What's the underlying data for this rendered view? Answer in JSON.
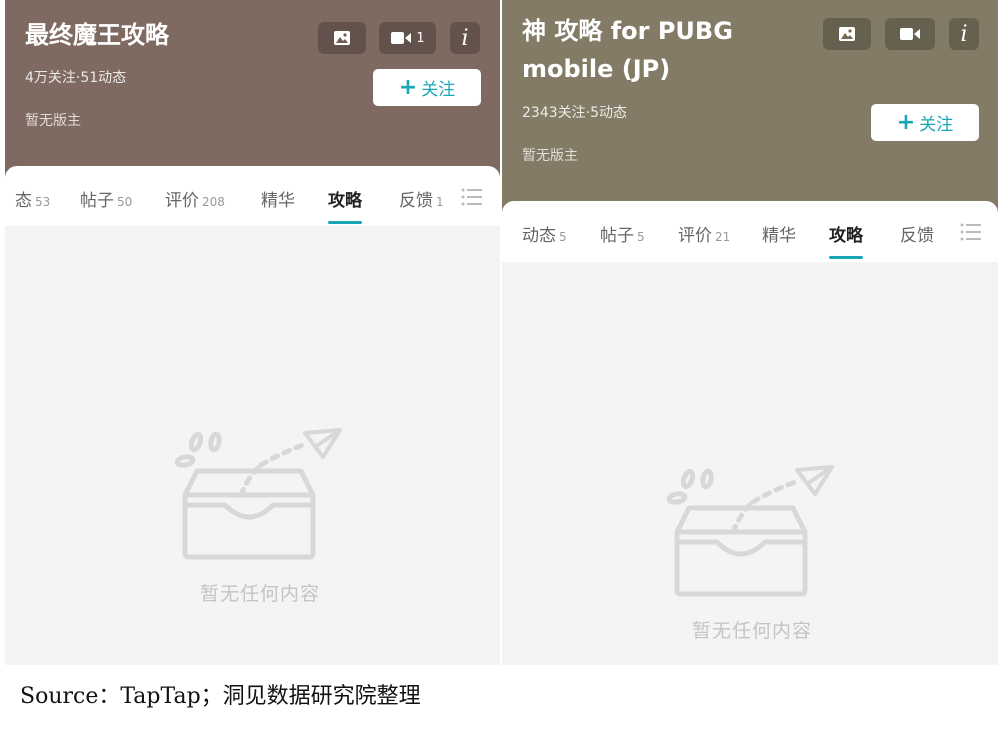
{
  "colors": {
    "left_header_bg": "#7f6a62",
    "right_header_bg": "#837b66",
    "accent": "#1aa7b5",
    "content_bg": "#f4f4f3",
    "empty_illustration": "#d8d8d8"
  },
  "left": {
    "title": "最终魔王攻略",
    "stats": "4万关注·51动态",
    "moderator": "暂无版主",
    "video_count": "1",
    "follow_label": "关注",
    "tabs": [
      {
        "label": "态",
        "count": "53"
      },
      {
        "label": "帖子",
        "count": "50"
      },
      {
        "label": "评价",
        "count": "208"
      },
      {
        "label": "精华",
        "count": ""
      },
      {
        "label": "攻略",
        "count": ""
      },
      {
        "label": "反馈",
        "count": "1"
      }
    ],
    "active_tab": "攻略",
    "empty_text": "暂无任何内容"
  },
  "right": {
    "title": "神 攻略 for PUBG mobile (JP)",
    "stats": "2343关注·5动态",
    "moderator": "暂无版主",
    "follow_label": "关注",
    "tabs": [
      {
        "label": "动态",
        "count": "5"
      },
      {
        "label": "帖子",
        "count": "5"
      },
      {
        "label": "评价",
        "count": "21"
      },
      {
        "label": "精华",
        "count": ""
      },
      {
        "label": "攻略",
        "count": ""
      },
      {
        "label": "反馈",
        "count": ""
      }
    ],
    "active_tab": "攻略",
    "empty_text": "暂无任何内容"
  },
  "icons": [
    "image-icon",
    "video-icon",
    "info-icon",
    "plus-icon",
    "list-menu-icon",
    "empty-inbox-icon",
    "paper-plane-icon"
  ],
  "source": "Source：TapTap；洞见数据研究院整理"
}
